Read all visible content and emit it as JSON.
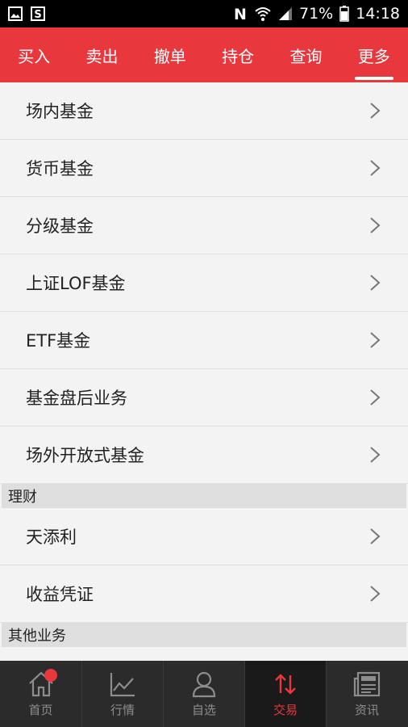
{
  "status_bar": {
    "battery": "71%",
    "time": "14:18",
    "icons": [
      "image-icon",
      "s-app-icon",
      "nfc-icon",
      "wifi-icon",
      "signal-icon",
      "battery-icon"
    ]
  },
  "tabs": [
    {
      "label": "买入",
      "active": false
    },
    {
      "label": "卖出",
      "active": false
    },
    {
      "label": "撤单",
      "active": false
    },
    {
      "label": "持仓",
      "active": false
    },
    {
      "label": "查询",
      "active": false
    },
    {
      "label": "更多",
      "active": true
    }
  ],
  "list": {
    "items": [
      "场内基金",
      "货币基金",
      "分级基金",
      "上证LOF基金",
      "ETF基金",
      "基金盘后业务",
      "场外开放式基金"
    ]
  },
  "sections": {
    "licai": {
      "header": "理财",
      "items": [
        "天添利",
        "收益凭证"
      ]
    },
    "other": {
      "header": "其他业务"
    }
  },
  "bottom_nav": [
    {
      "label": "首页",
      "icon": "home-icon",
      "badge": true
    },
    {
      "label": "行情",
      "icon": "chart-icon"
    },
    {
      "label": "自选",
      "icon": "person-icon"
    },
    {
      "label": "交易",
      "icon": "trade-arrows-icon",
      "active": true
    },
    {
      "label": "资讯",
      "icon": "news-icon"
    }
  ],
  "colors": {
    "accent": "#e8383d",
    "nav_bg": "#2b2b2b",
    "list_bg": "#f3f3f3"
  }
}
